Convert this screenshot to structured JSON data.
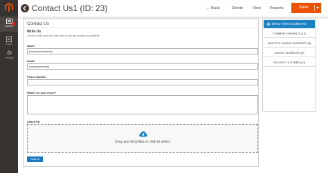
{
  "sidebar": {
    "items": [
      {
        "label": "Content",
        "icon": "content-icon",
        "active": true
      },
      {
        "label": "Pages",
        "icon": "pages-icon"
      },
      {
        "label": "Settings",
        "icon": "gear-icon"
      }
    ]
  },
  "header": {
    "title": "Contact Us1 (ID: 23)",
    "actions": {
      "back": "Back",
      "delete": "Delete",
      "view": "View",
      "reports": "Reports",
      "save": "Save"
    }
  },
  "form": {
    "panel_title": "Contact Us",
    "heading": "Write Us",
    "intro": "Jot us a note and we'll get back to you as quickly as possible.",
    "fields": {
      "name": {
        "label": "Name*",
        "value": "{customer.fullname}"
      },
      "email": {
        "label": "Email*",
        "value": "{customer.email}"
      },
      "phone": {
        "label": "Phone Number",
        "value": ""
      },
      "mind": {
        "label": "What's on your mind?*",
        "value": ""
      },
      "attach": {
        "label": "Attach file",
        "dropzone_text": "Drag and drop files or click to select"
      }
    },
    "submit_label": "Submit"
  },
  "elements_panel": {
    "header": "DRAG FORM ELEMENTS",
    "groups": [
      "COMMON ELEMENTS (12)",
      "MULTIPLE CHOICE ELEMENTS (6)",
      "LAYOUT ELEMENTS (5)",
      "SECURITY & OTHER (10)"
    ]
  },
  "colors": {
    "sidebar_bg": "#373330",
    "accent_orange": "#eb5202",
    "accent_blue": "#1b82c4",
    "submit_blue": "#1979c3"
  }
}
